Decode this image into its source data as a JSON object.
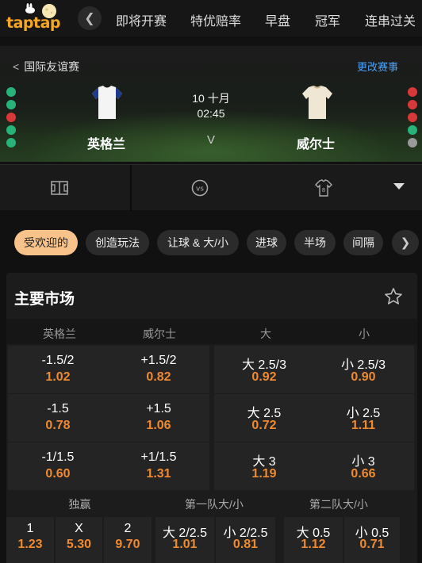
{
  "topnav": {
    "logo_text": "taptap",
    "tabs": [
      "即将开赛",
      "特优赔率",
      "早盘",
      "冠军",
      "连串过关"
    ]
  },
  "match": {
    "league": "国际友谊赛",
    "change_label": "更改赛事",
    "date": "10 十月",
    "time": "02:45",
    "vs": "V",
    "home": "英格兰",
    "away": "威尔士",
    "home_form": [
      "win",
      "win",
      "loss",
      "win",
      "win"
    ],
    "away_form": [
      "loss",
      "loss",
      "loss",
      "win",
      "draw"
    ],
    "colors": {
      "win": "#27b37a",
      "loss": "#d9383a",
      "draw": "#9a9a9a"
    }
  },
  "filters": [
    "受欢迎的",
    "创造玩法",
    "让球 & 大/小",
    "进球",
    "半场",
    "间隔"
  ],
  "markets": {
    "title": "主要市场",
    "headers": [
      "英格兰",
      "威尔士",
      "大",
      "小"
    ],
    "rows": [
      [
        {
          "line": "-1.5/2",
          "odds": "1.02"
        },
        {
          "line": "+1.5/2",
          "odds": "0.82"
        },
        {
          "line": "大 2.5/3",
          "odds": "0.92"
        },
        {
          "line": "小 2.5/3",
          "odds": "0.90"
        }
      ],
      [
        {
          "line": "-1.5",
          "odds": "0.78"
        },
        {
          "line": "+1.5",
          "odds": "1.06"
        },
        {
          "line": "大 2.5",
          "odds": "0.72"
        },
        {
          "line": "小 2.5",
          "odds": "1.11"
        }
      ],
      [
        {
          "line": "-1/1.5",
          "odds": "0.60"
        },
        {
          "line": "+1/1.5",
          "odds": "1.31"
        },
        {
          "line": "大 3",
          "odds": "1.19"
        },
        {
          "line": "小 3",
          "odds": "0.66"
        }
      ]
    ],
    "sub_headers": [
      "独赢",
      "第一队大/小",
      "第二队大/小"
    ],
    "mini": [
      {
        "line": "1",
        "odds": "1.23"
      },
      {
        "line": "X",
        "odds": "5.30"
      },
      {
        "line": "2",
        "odds": "9.70"
      },
      {
        "line": "大 2/2.5",
        "odds": "1.01"
      },
      {
        "line": "小 2/2.5",
        "odds": "0.81"
      },
      {
        "line": "大 0.5",
        "odds": "1.12"
      },
      {
        "line": "小 0.5",
        "odds": "0.71"
      }
    ]
  }
}
